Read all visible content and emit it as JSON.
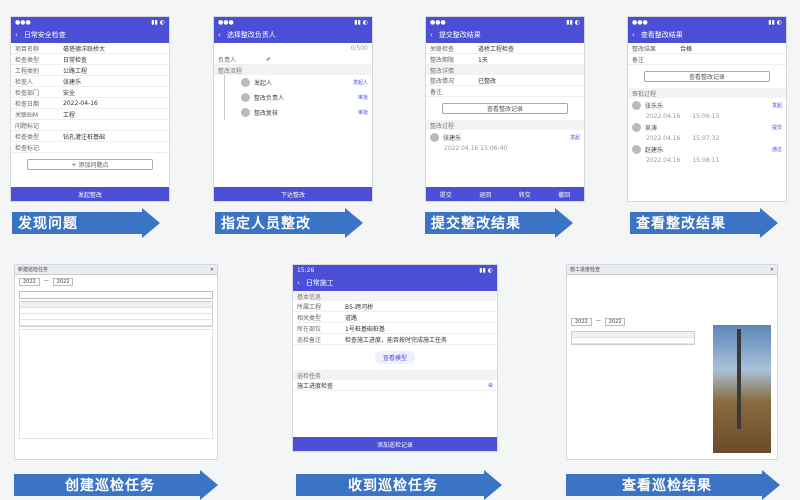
{
  "top_row": {
    "panel1": {
      "nav_title": "日常安全检查",
      "rows": [
        {
          "k": "项目名称",
          "v": "毫塔德洋跃桥大"
        },
        {
          "k": "检查类型",
          "v": "日常检查"
        },
        {
          "k": "工程类别",
          "v": "公路工程"
        },
        {
          "k": "检查人",
          "v": "张建乐"
        },
        {
          "k": "检查部门",
          "v": "安全"
        },
        {
          "k": "检查日期",
          "v": "2022-04-16"
        },
        {
          "k": "关联BIM",
          "v": "工程"
        },
        {
          "k": "问题标记",
          "v": ""
        },
        {
          "k": "检查类型",
          "v": "钻孔灌注桩基础"
        },
        {
          "k": "检查标记",
          "v": ""
        }
      ],
      "add_button": "+ 添加问题点",
      "submit": "发起整改"
    },
    "panel2": {
      "nav_title": "选择整改负责人",
      "counter": "0/500",
      "field": "负责人",
      "section": "整改流程",
      "steps": [
        {
          "name": "发起人",
          "tag": "发起人"
        },
        {
          "name": "整改负责人",
          "tag": "审批"
        },
        {
          "name": "整改复核",
          "tag": "审批"
        }
      ],
      "submit": "下达整改"
    },
    "panel3": {
      "nav_title": "提交整改结果",
      "rows": [
        {
          "k": "关联检查",
          "v": "道桥工程检查"
        },
        {
          "k": "整改期限",
          "v": "1天"
        }
      ],
      "section1": "整改详情",
      "rows2": [
        {
          "k": "整改情况",
          "v": "已整改"
        },
        {
          "k": "备注",
          "v": ""
        }
      ],
      "button": "查看整改记录",
      "section2": "整改过程",
      "person": {
        "name": "张建乐",
        "time": "2022.04.16 15:06:40",
        "tag": "发起"
      },
      "tabs": [
        "提交",
        "退回",
        "转交",
        "撤回"
      ]
    },
    "panel4": {
      "nav_title": "查看整改结果",
      "rows": [
        {
          "k": "整改结果",
          "v": "合格"
        },
        {
          "k": "备注",
          "v": ""
        }
      ],
      "button": "查看整改记录",
      "section": "审批过程",
      "persons": [
        {
          "name": "张乐乐",
          "date": "2022.04.16",
          "time": "15:06:15",
          "tag": "发起"
        },
        {
          "name": "吴涛",
          "date": "2022.04.16",
          "time": "15:07:32",
          "tag": "提交"
        },
        {
          "name": "赵建乐",
          "date": "2022.04.16",
          "time": "15:08:11",
          "tag": "通过"
        }
      ]
    }
  },
  "bottom_row": {
    "panel5": {
      "title": "新建巡检任务",
      "year_from": "2022",
      "year_to": "2022"
    },
    "panel6": {
      "time": "15:26",
      "nav_title": "日常施工",
      "section": "基本信息",
      "rows": [
        {
          "k": "所属工程",
          "v": "B5-跨河桥"
        },
        {
          "k": "相关类型",
          "v": "道路"
        },
        {
          "k": "所在部位",
          "v": "1号桩基础桩基"
        },
        {
          "k": "巡检备注",
          "v": "检查施工进度，能否按时完成施工任务"
        }
      ],
      "model_button": "查看模型",
      "tasks_section": "巡检任务",
      "task": "施工进度检查",
      "submit": "添加巡检记录"
    },
    "panel7": {
      "title": "施工进度检查",
      "year_from": "2022",
      "year_to": "2022"
    }
  },
  "arrows": {
    "a1": "发现问题",
    "a2": "指定人员整改",
    "a3": "提交整改结果",
    "a4": "查看整改结果",
    "a5": "创建巡检任务",
    "a6": "收到巡检任务",
    "a7": "查看巡检结果"
  },
  "colors": {
    "accent": "#4a4fd6",
    "arrow": "#3b74c4"
  }
}
